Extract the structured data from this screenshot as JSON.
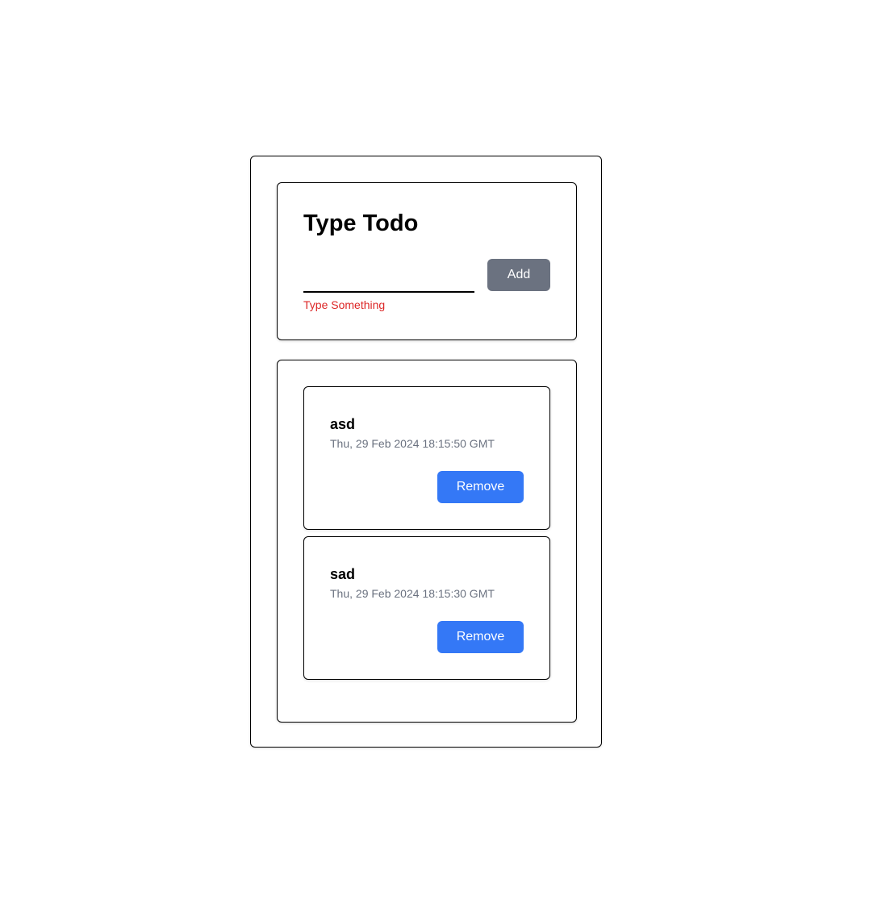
{
  "form": {
    "title": "Type Todo",
    "input_value": "",
    "error": "Type Something",
    "add_label": "Add"
  },
  "todos": [
    {
      "title": "asd",
      "date": "Thu, 29 Feb 2024 18:15:50 GMT",
      "remove_label": "Remove"
    },
    {
      "title": "sad",
      "date": "Thu, 29 Feb 2024 18:15:30 GMT",
      "remove_label": "Remove"
    }
  ],
  "colors": {
    "add_button": "#6b7280",
    "remove_button": "#3478f6",
    "error_text": "#dc2626",
    "date_text": "#6b7280"
  }
}
